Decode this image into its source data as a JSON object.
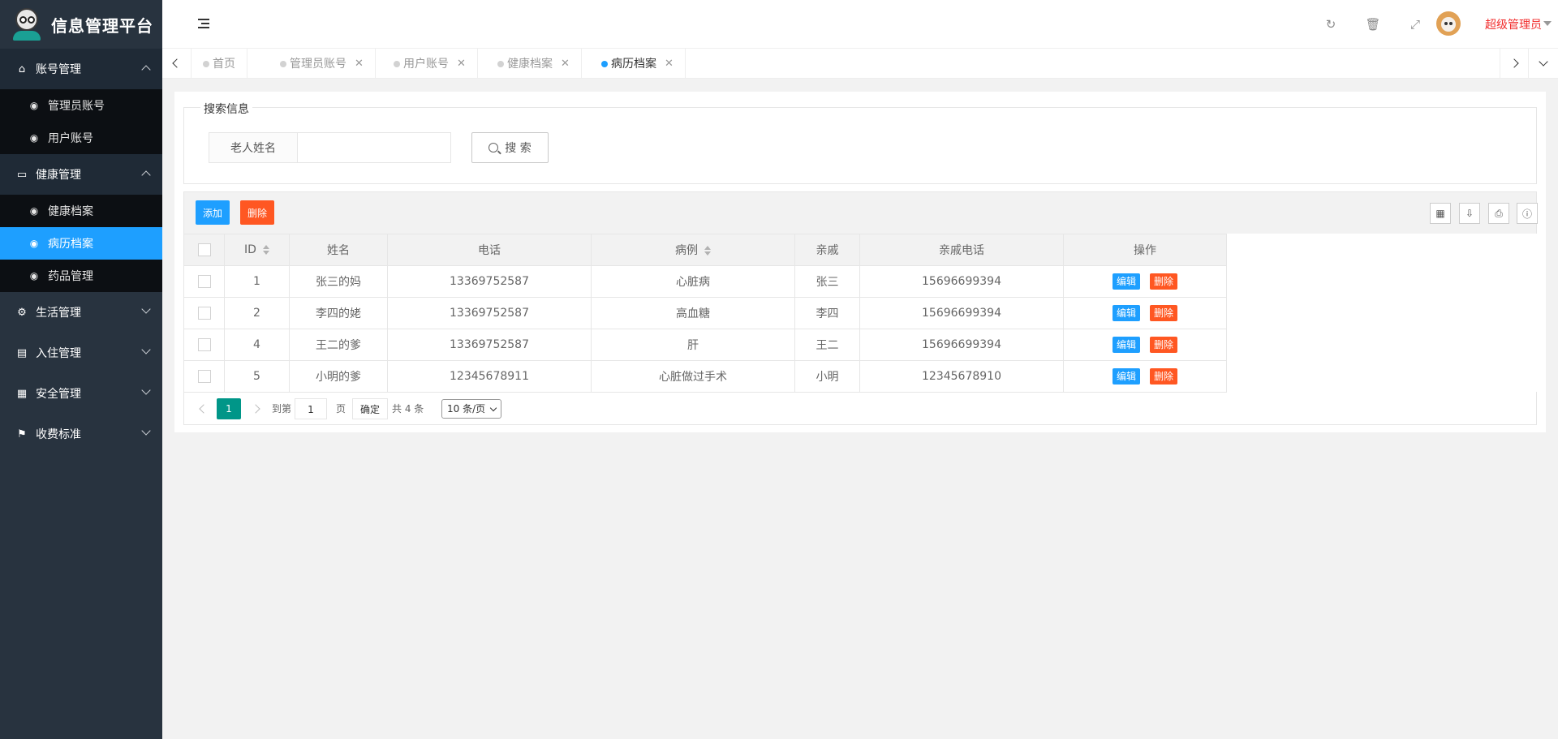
{
  "logo": {
    "title": "信息管理平台"
  },
  "sidebar": {
    "groups": [
      {
        "label": "账号管理",
        "icon": "home-icon",
        "items": [
          "管理员账号",
          "用户账号"
        ]
      },
      {
        "label": "健康管理",
        "icon": "window-icon",
        "items": [
          "健康档案",
          "病历档案",
          "药品管理"
        ]
      },
      {
        "label": "生活管理",
        "icon": "gears-icon"
      },
      {
        "label": "入住管理",
        "icon": "document-icon"
      },
      {
        "label": "安全管理",
        "icon": "calendar-icon"
      },
      {
        "label": "收费标准",
        "icon": "flag-icon"
      }
    ],
    "active_item": "病历档案"
  },
  "header": {
    "user_name": "超级管理员"
  },
  "tabs": [
    {
      "label": "首页",
      "closable": false
    },
    {
      "label": "管理员账号",
      "closable": true
    },
    {
      "label": "用户账号",
      "closable": true
    },
    {
      "label": "健康档案",
      "closable": true
    },
    {
      "label": "病历档案",
      "closable": true,
      "active": true
    }
  ],
  "search": {
    "legend": "搜索信息",
    "field_label": "老人姓名",
    "value": "",
    "button": "搜 索"
  },
  "toolbar": {
    "add": "添加",
    "delete": "删除"
  },
  "table": {
    "columns": [
      "ID",
      "姓名",
      "电话",
      "病例",
      "亲戚",
      "亲戚电话",
      "操作"
    ],
    "edit_label": "编辑",
    "delete_label": "删除",
    "rows": [
      [
        "1",
        "张三的妈",
        "13369752587",
        "心脏病",
        "张三",
        "15696699394"
      ],
      [
        "2",
        "李四的姥",
        "13369752587",
        "高血糖",
        "李四",
        "15696699394"
      ],
      [
        "4",
        "王二的爹",
        "13369752587",
        "肝",
        "王二",
        "15696699394"
      ],
      [
        "5",
        "小明的爹",
        "12345678911",
        "心脏做过手术",
        "小明",
        "12345678910"
      ]
    ]
  },
  "pager": {
    "current": "1",
    "goto_prefix": "到第",
    "goto_value": "1",
    "page_unit": "页",
    "confirm": "确定",
    "total": "共 4 条",
    "page_size": "10 条/页"
  },
  "colors": {
    "sidebar": "#28333f",
    "active": "#1e9fff",
    "danger": "#ff5722",
    "pager_current": "#009688",
    "user_name": "#f12b2b"
  }
}
